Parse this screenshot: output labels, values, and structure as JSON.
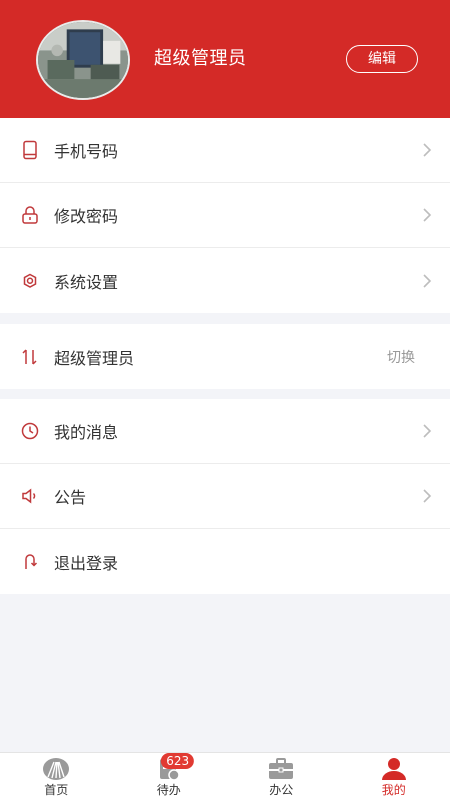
{
  "profile": {
    "username": "超级管理员",
    "edit_label": "编辑"
  },
  "menu_group_1": [
    {
      "label": "手机号码",
      "icon": "phone-icon"
    },
    {
      "label": "修改密码",
      "icon": "lock-icon"
    },
    {
      "label": "系统设置",
      "icon": "gear-icon"
    }
  ],
  "role_switch": {
    "label": "超级管理员",
    "action": "切换",
    "icon": "switch-arrows-icon"
  },
  "menu_group_2": [
    {
      "label": "我的消息",
      "icon": "clock-icon"
    },
    {
      "label": "公告",
      "icon": "speaker-icon"
    },
    {
      "label": "退出登录",
      "icon": "logout-icon"
    }
  ],
  "tabbar": {
    "items": [
      {
        "label": "首页",
        "icon": "home-logo-icon"
      },
      {
        "label": "待办",
        "icon": "todo-icon",
        "badge": "623"
      },
      {
        "label": "办公",
        "icon": "briefcase-icon"
      },
      {
        "label": "我的",
        "icon": "user-icon",
        "active": true
      }
    ]
  },
  "colors": {
    "accent": "#d42a27",
    "background": "#f3f4f8",
    "icon_stroke": "#c0393b",
    "tab_icon_inactive": "#9a9a9a"
  }
}
